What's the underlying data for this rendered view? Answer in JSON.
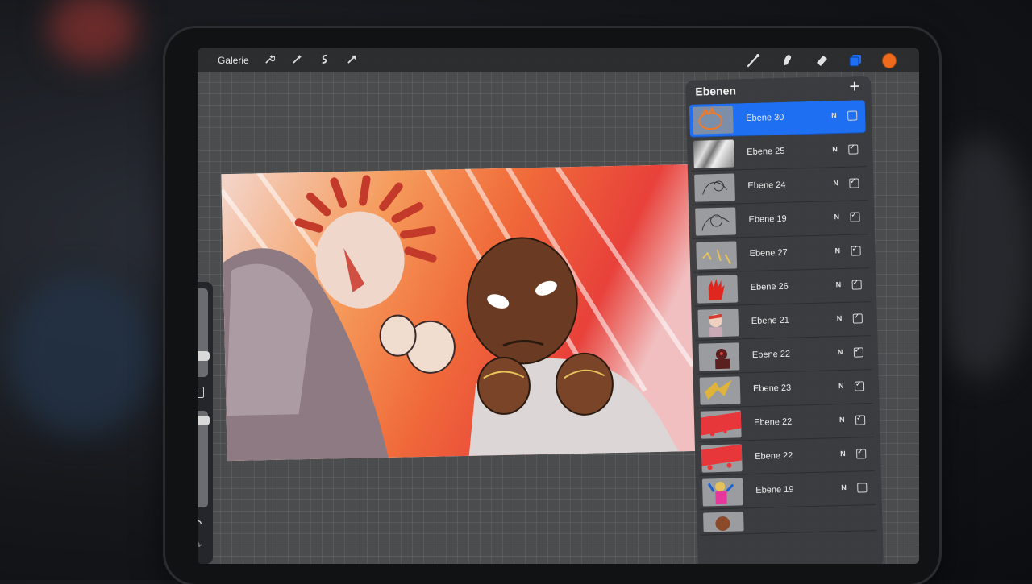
{
  "toolbar": {
    "gallery_label": "Galerie",
    "left_icons": [
      "wrench-icon",
      "magic-wand-icon",
      "selection-icon",
      "transform-arrow-icon"
    ],
    "right_icons": [
      "brush-icon",
      "smudge-icon",
      "eraser-icon",
      "layers-icon",
      "color-swatch"
    ],
    "active_color": "#ee6a1c",
    "layers_accent": "#1f6ff2"
  },
  "layers_panel": {
    "title": "Ebenen",
    "add_label": "+",
    "layers": [
      {
        "name": "Ebene 30",
        "mode": "N",
        "visible": false,
        "active": true
      },
      {
        "name": "Ebene 25",
        "mode": "N",
        "visible": true,
        "active": false
      },
      {
        "name": "Ebene 24",
        "mode": "N",
        "visible": true,
        "active": false
      },
      {
        "name": "Ebene 19",
        "mode": "N",
        "visible": true,
        "active": false
      },
      {
        "name": "Ebene 27",
        "mode": "N",
        "visible": true,
        "active": false
      },
      {
        "name": "Ebene 26",
        "mode": "N",
        "visible": true,
        "active": false
      },
      {
        "name": "Ebene 21",
        "mode": "N",
        "visible": true,
        "active": false
      },
      {
        "name": "Ebene 22",
        "mode": "N",
        "visible": true,
        "active": false
      },
      {
        "name": "Ebene 23",
        "mode": "N",
        "visible": true,
        "active": false
      },
      {
        "name": "Ebene 22",
        "mode": "N",
        "visible": true,
        "active": false
      },
      {
        "name": "Ebene 22",
        "mode": "N",
        "visible": true,
        "active": false
      },
      {
        "name": "Ebene 19",
        "mode": "N",
        "visible": false,
        "active": false
      }
    ]
  },
  "sidebar": {
    "undo_icon": "undo-icon",
    "redo_icon": "redo-icon"
  }
}
